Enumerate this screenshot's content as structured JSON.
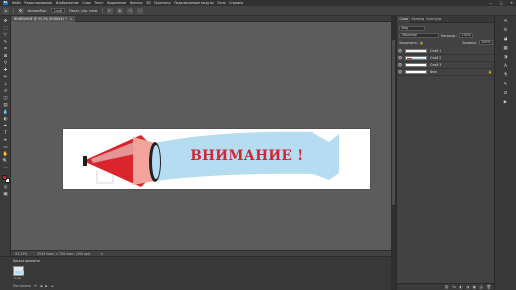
{
  "menubar": {
    "app_logo": "Ps",
    "items": [
      "Файл",
      "Редактирование",
      "Изображение",
      "Слои",
      "Текст",
      "Выделение",
      "Фильтр",
      "3D",
      "Просмотр",
      "Подключаемые модули",
      "Окно",
      "Справка"
    ],
    "window_controls": [
      "—",
      "▢",
      "✕"
    ]
  },
  "options_bar": {
    "home_icon": "home-icon",
    "tool_icon": "move-icon",
    "auto_select_label": "Автовыбор:",
    "auto_select_value": "Слой",
    "transform_label": "Показ. упр. элем."
  },
  "document": {
    "tab_title": "ВНИМАНИЕ @ 93,3% (RGB/8#) *",
    "close_glyph": "✕",
    "banner_text": "ВНИМАНИЕ !"
  },
  "status": {
    "zoom": "93,33%",
    "info": "3543 пикс. x 755 пикс. (300 ppi)",
    "arrow": ">"
  },
  "timeline": {
    "title": "Шкала времени",
    "frame_label": "0 сек.",
    "loop_label": "Постоянно",
    "controls": [
      "⏮",
      "◀",
      "▶",
      "⏭"
    ]
  },
  "panel": {
    "tabs": [
      "Слои",
      "Каналы",
      "Контуры"
    ],
    "filter_label": "Вид",
    "blend_mode": "Обычные",
    "opacity_label": "Непрозр.:",
    "opacity_value": "100%",
    "lock_label": "Закрепить:",
    "fill_label": "Заливка:",
    "fill_value": "100%",
    "layers": [
      {
        "name": "Слой 1"
      },
      {
        "name": "Слой 2"
      },
      {
        "name": "Слой 3"
      },
      {
        "name": "Фон"
      }
    ],
    "bottom_icons": [
      "⛓",
      "fx",
      "◐",
      "◑",
      "▣",
      "▤",
      "🗑"
    ]
  },
  "colors": {
    "foreground": "#d61f26",
    "background": "#ffffff",
    "accent": "#1b73d3",
    "banner_blue": "#b5dcf0",
    "banner_text": "#d42432"
  }
}
